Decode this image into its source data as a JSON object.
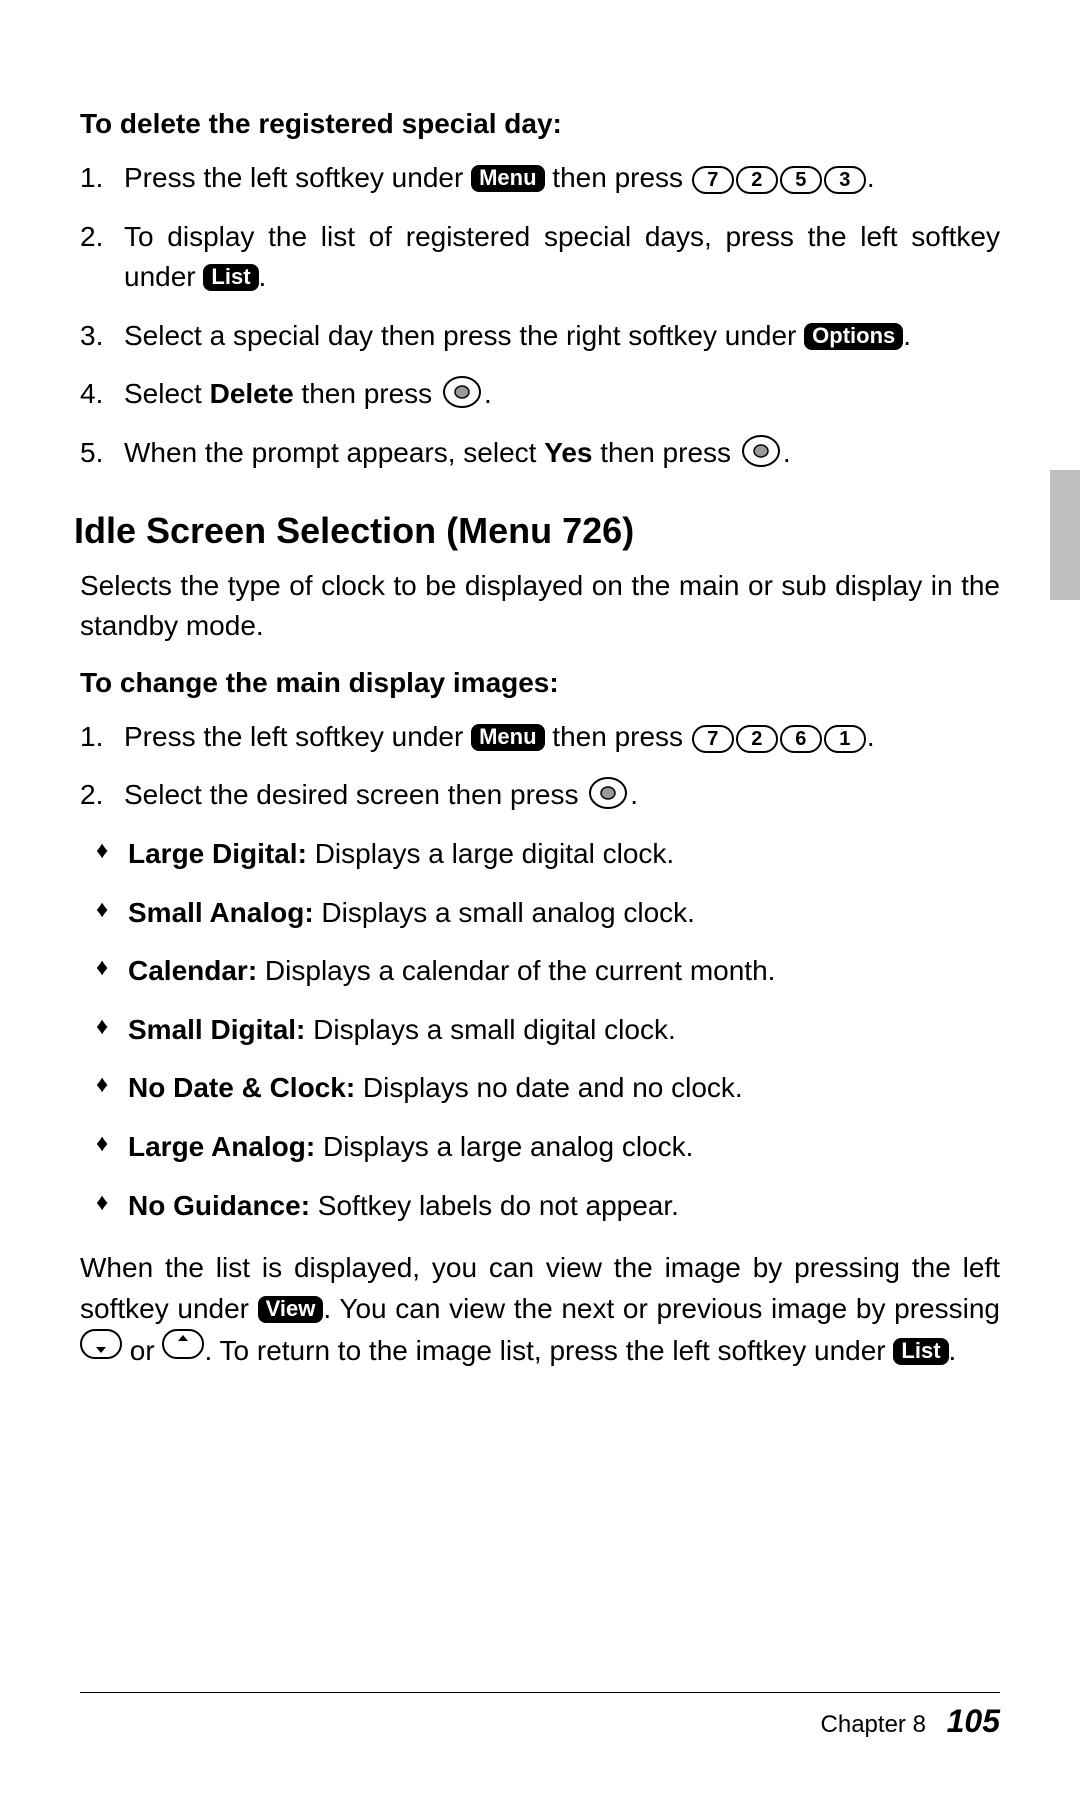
{
  "section1": {
    "heading": "To delete the registered special day:",
    "step1_a": "Press the left softkey under ",
    "step1_menu": "Menu",
    "step1_b": " then press ",
    "step1_keys": [
      "7",
      "2",
      "5",
      "3"
    ],
    "step1_c": ".",
    "step2_a": "To display the list of registered special days, press the left softkey under ",
    "step2_list": "List",
    "step2_b": ".",
    "step3_a": "Select a special day then press the right softkey under ",
    "step3_options": "Options",
    "step3_b": ".",
    "step4_a": "Select ",
    "step4_bold": "Delete",
    "step4_b": " then press ",
    "step4_c": ".",
    "step5_a": "When the prompt appears, select ",
    "step5_bold": "Yes",
    "step5_b": " then press ",
    "step5_c": "."
  },
  "section2": {
    "title": "Idle Screen Selection (Menu 726)",
    "intro": "Selects the type of clock to be displayed on the main or sub display in the standby mode.",
    "subhead": "To change the main display images:",
    "step1_a": "Press the left softkey under ",
    "step1_menu": "Menu",
    "step1_b": " then press ",
    "step1_keys": [
      "7",
      "2",
      "6",
      "1"
    ],
    "step1_c": ".",
    "step2_a": "Select the desired screen then press ",
    "step2_b": ".",
    "options": [
      {
        "name": "Large Digital:",
        "desc": " Displays a large digital clock."
      },
      {
        "name": "Small Analog:",
        "desc": " Displays a small analog clock."
      },
      {
        "name": "Calendar:",
        "desc": " Displays a calendar of the current month."
      },
      {
        "name": "Small Digital:",
        "desc": " Displays a small digital clock."
      },
      {
        "name": "No Date & Clock:",
        "desc": " Displays no date and no clock."
      },
      {
        "name": "Large Analog:",
        "desc": " Displays a large analog clock."
      },
      {
        "name": "No Guidance:",
        "desc": " Softkey labels do not appear."
      }
    ],
    "tail_a": "When the list is displayed, you can view the image by pressing the left softkey under ",
    "tail_view": "View",
    "tail_b": ". You can view the next or previous image by pressing ",
    "tail_or": " or ",
    "tail_c": ". To return to the image list, press the left softkey under ",
    "tail_list": "List",
    "tail_d": "."
  },
  "footer": {
    "chapter": "Chapter 8",
    "page": "105"
  }
}
